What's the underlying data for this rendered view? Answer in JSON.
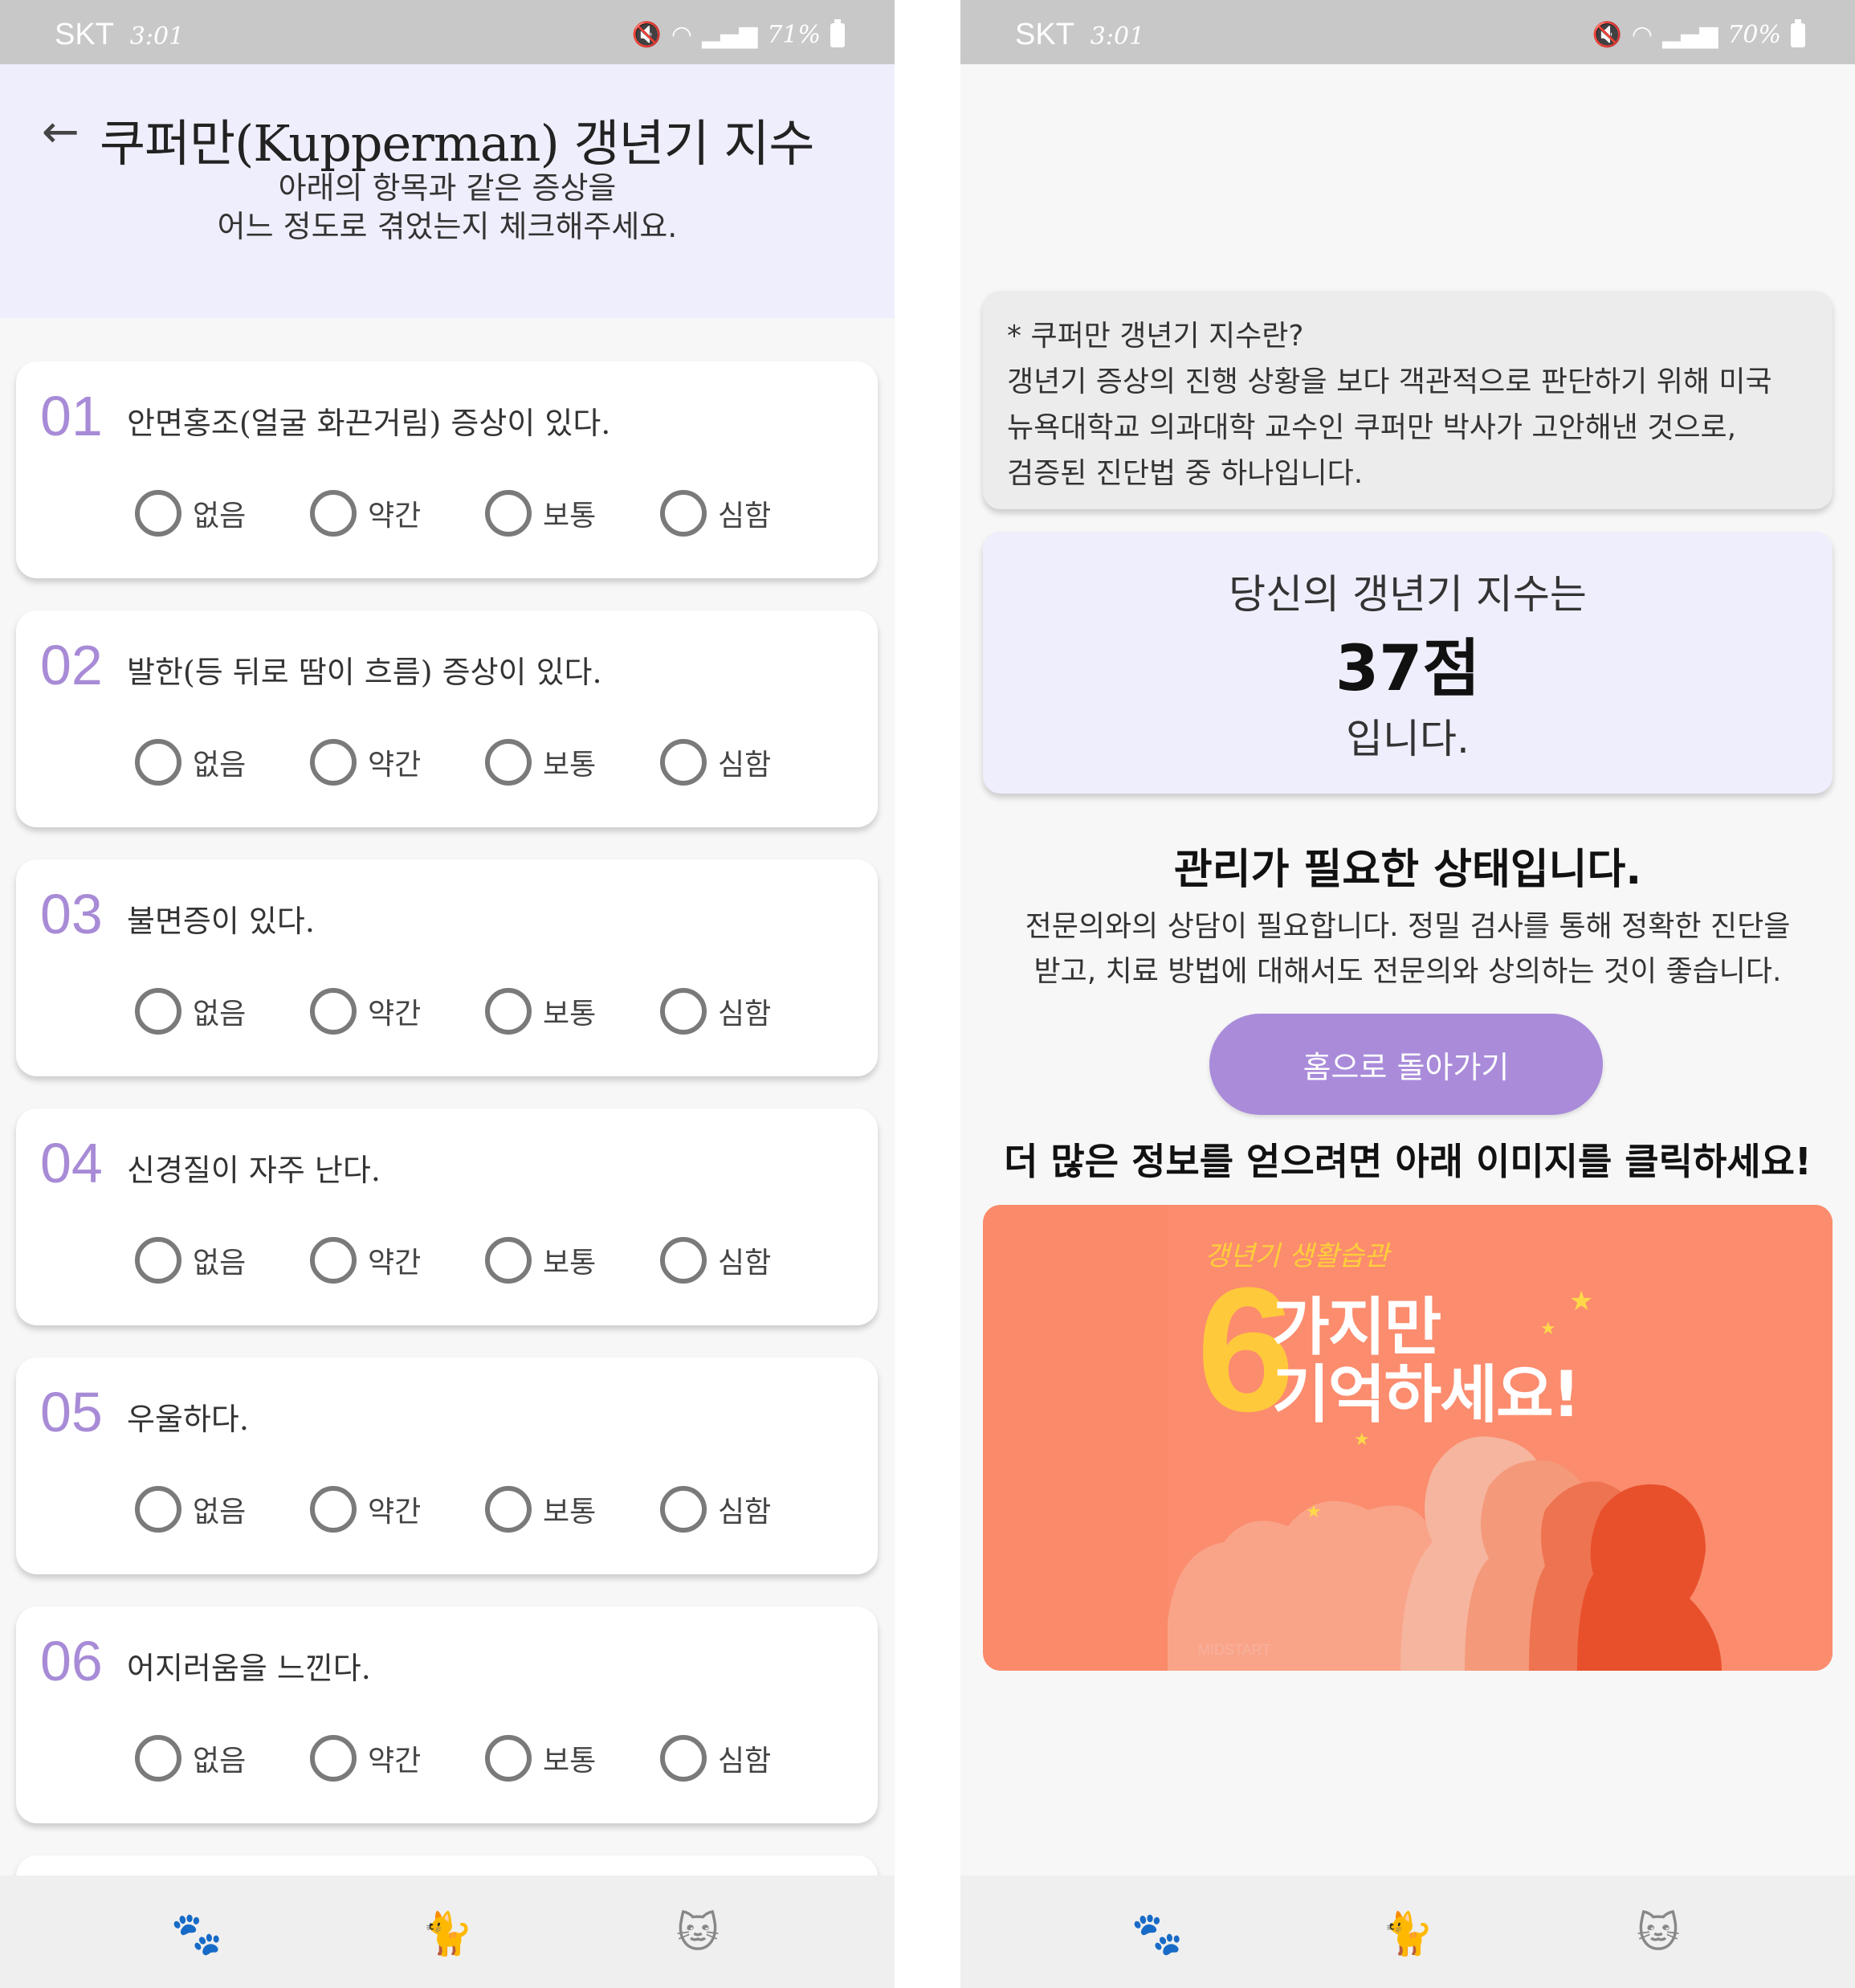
{
  "left": {
    "status": {
      "carrier": "SKT",
      "time": "3:01",
      "battery": "71%"
    },
    "header": {
      "title": "쿠퍼만(Kupperman) 갱년기 지수",
      "subtitle_line1": "아래의 항목과 같은 증상을",
      "subtitle_line2": "어느 정도로 겪었는지 체크해주세요."
    },
    "options": [
      "없음",
      "약간",
      "보통",
      "심함"
    ],
    "questions": [
      {
        "num": "01",
        "text": "안면홍조(얼굴 화끈거림) 증상이 있다."
      },
      {
        "num": "02",
        "text": "발한(등 뒤로 땀이 흐름) 증상이 있다."
      },
      {
        "num": "03",
        "text": "불면증이 있다."
      },
      {
        "num": "04",
        "text": "신경질이 자주 난다."
      },
      {
        "num": "05",
        "text": "우울하다."
      },
      {
        "num": "06",
        "text": "어지러움을 느낀다."
      }
    ]
  },
  "right": {
    "status": {
      "carrier": "SKT",
      "time": "3:01",
      "battery": "70%"
    },
    "info": {
      "line1": "* 쿠퍼만 갱년기 지수란?",
      "line2": "갱년기 증상의 진행 상황을 보다 객관적으로 판단하기 위해 미국",
      "line3": "뉴욕대학교 의과대학 교수인 쿠퍼만 박사가 고안해낸 것으로,",
      "line4": "검증된 진단법 중 하나입니다."
    },
    "score": {
      "line1": "당신의 갱년기 지수는",
      "value": "37점",
      "line3": "입니다."
    },
    "status_text": "관리가 필요한 상태입니다.",
    "advice_line1": "전문의와의 상담이 필요합니다. 정밀 검사를 통해 정확한 진단을",
    "advice_line2": "받고, 치료 방법에 대해서도 전문의와 상의하는 것이 좋습니다.",
    "home_button": "홈으로 돌아가기",
    "more_info": "더 많은 정보를 얻으려면 아래 이미지를 클릭하세요!",
    "banner": {
      "tag": "갱년기 생활습관",
      "number": "6",
      "line1": "가지만",
      "line2": "기억하세요!",
      "brand": "MIDSTART"
    }
  },
  "nav": {
    "icons": [
      "paw-icon",
      "sleeping-cat-icon",
      "cat-icon"
    ]
  },
  "colors": {
    "accent": "#a98bda",
    "header_bg": "#efeefc",
    "banner_bg": "#fa8a6a",
    "number_color": "#a88bd6"
  }
}
